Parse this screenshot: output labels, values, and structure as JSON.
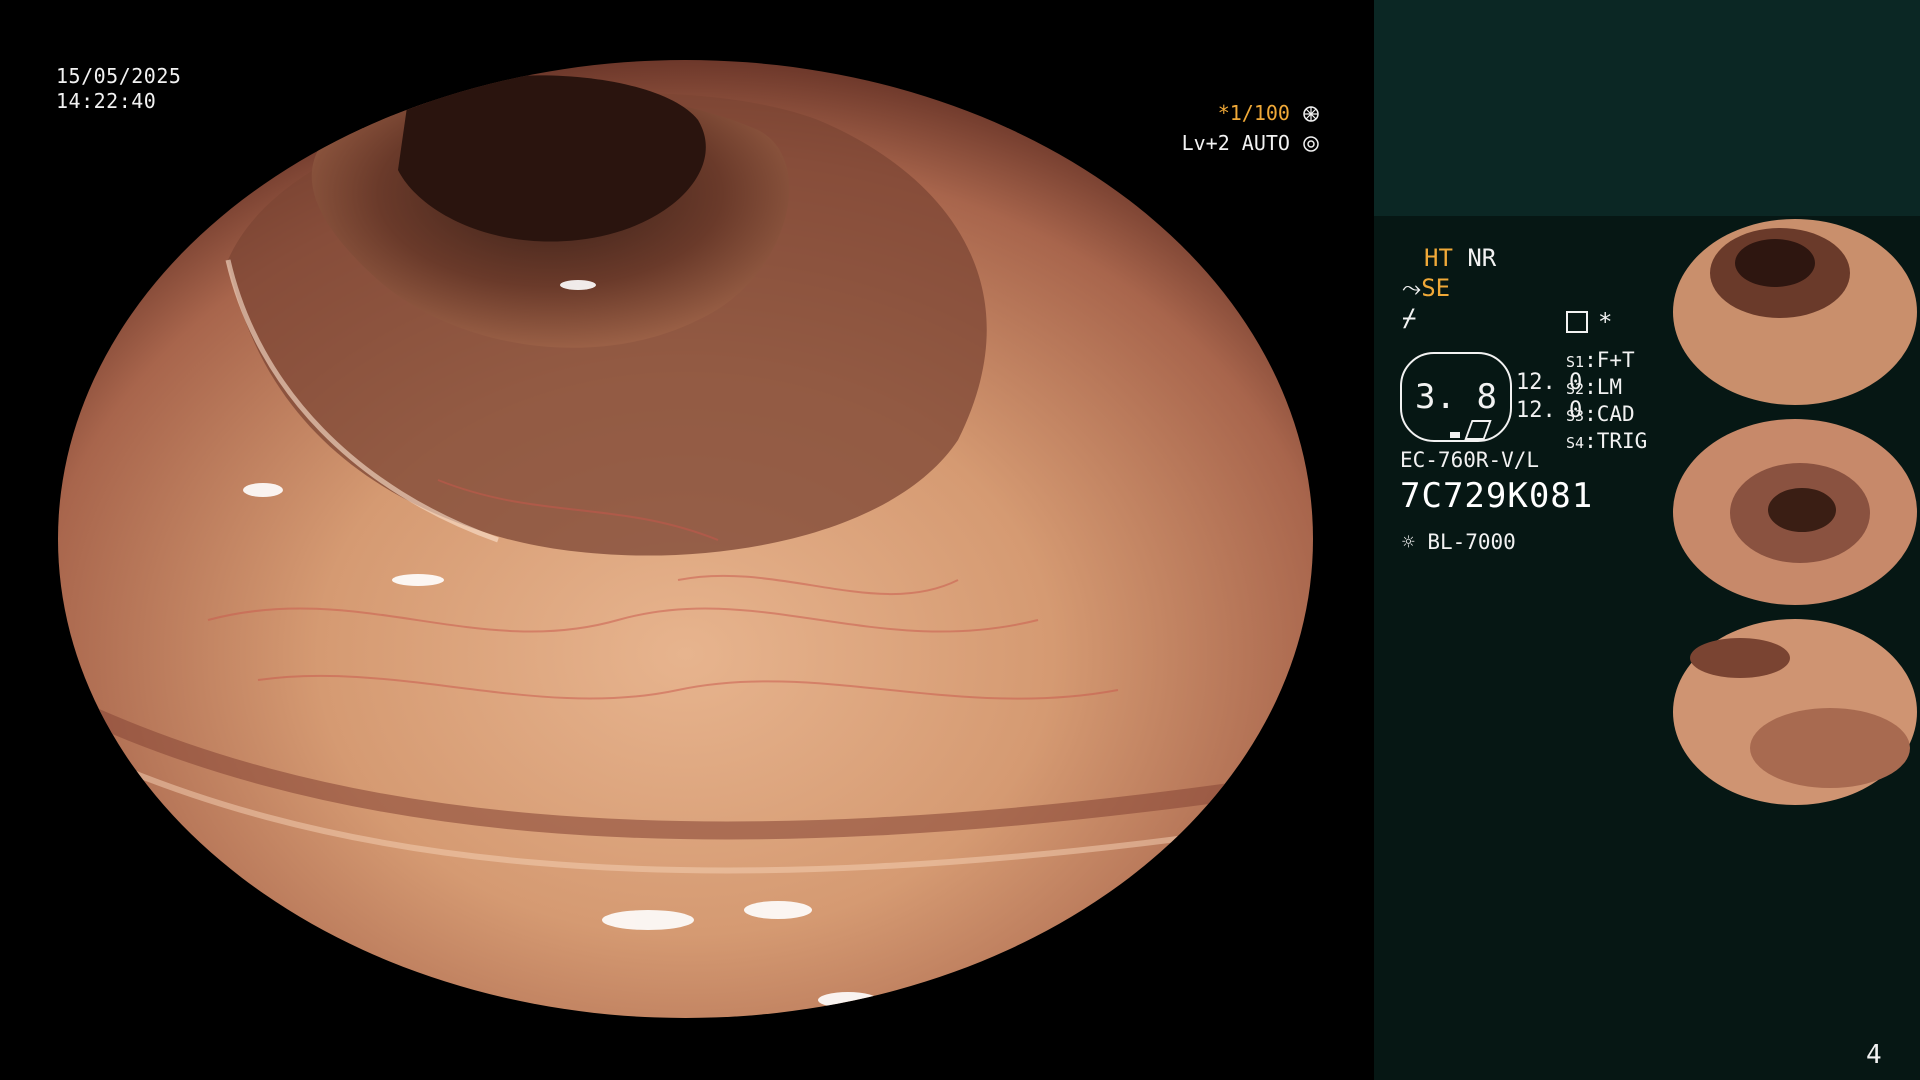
{
  "overlay": {
    "date": "15/05/2025",
    "time": "14:22:40",
    "shutter": "*1/100",
    "level": "Lv+2 AUTO"
  },
  "panel": {
    "status": {
      "ht": "HT",
      "nr": "NR",
      "se": "SE"
    },
    "oval_value": "3. 8",
    "values": [
      "12. 0",
      "12. 0"
    ],
    "scene_labels": [
      {
        "key": "S1",
        "value": "F+T"
      },
      {
        "key": "S2",
        "value": "LM"
      },
      {
        "key": "S3",
        "value": "CAD"
      },
      {
        "key": "S4",
        "value": "TRIG"
      }
    ],
    "scope_model": "EC-760R-V/L",
    "serial": "7C729K081",
    "lamp": "BL-7000"
  },
  "page_number": "4",
  "colors": {
    "accent": "#f0a938",
    "panel_bg": "#061714",
    "panel_top_bg": "#0b2724"
  },
  "icons": [
    "shutter-icon",
    "auto-iris-icon",
    "filter-icon",
    "signal-icon",
    "memory-icon",
    "star-icon",
    "lamp-icon"
  ]
}
